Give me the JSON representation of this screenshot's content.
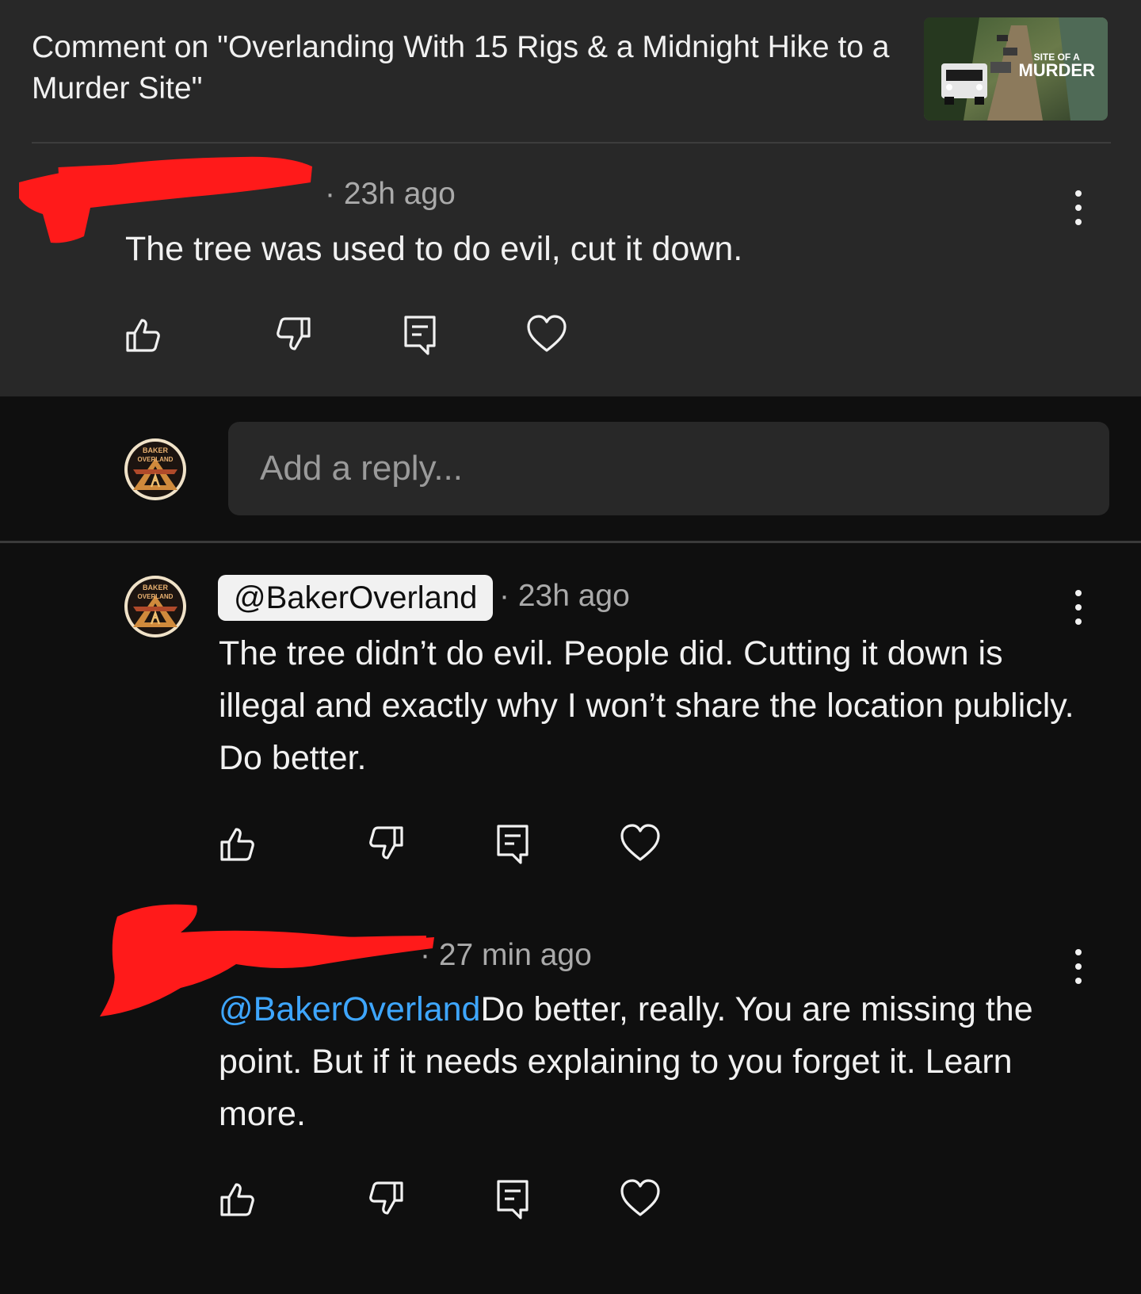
{
  "header": {
    "title": "Comment on \"Overlanding With 15 Rigs & a Midnight Hike to a Murder Site\"",
    "thumbnail_caption_line1": "SITE OF A",
    "thumbnail_caption_line2": "MURDER"
  },
  "comment": {
    "author": "[redacted]",
    "time": "· 23h ago",
    "text": "The tree was used to do evil, cut it down."
  },
  "reply_box": {
    "placeholder": "Add a reply...",
    "avatar_text_top": "BAKER",
    "avatar_text_bottom": "OVERLAND"
  },
  "replies": [
    {
      "author": "@BakerOverland",
      "time": "· 23h ago",
      "text": "The tree didn’t do evil. People did. Cutting it down is illegal and exactly why I won’t share the location publicly. Do better.",
      "avatar_text_top": "BAKER",
      "avatar_text_bottom": "OVERLAND"
    },
    {
      "author": "[redacted]",
      "time": "· 27 min ago",
      "mention": "@BakerOverland",
      "text": "Do better, really. You are missing the point. But if it needs explaining to you forget it. Learn more."
    }
  ],
  "icons": [
    "like-icon",
    "dislike-icon",
    "reply-icon",
    "heart-icon",
    "more-vert-icon"
  ],
  "colors": {
    "background": "#0f0f0f",
    "surface": "#282828",
    "mention": "#3ea6ff",
    "redaction": "#ff1a1a"
  }
}
